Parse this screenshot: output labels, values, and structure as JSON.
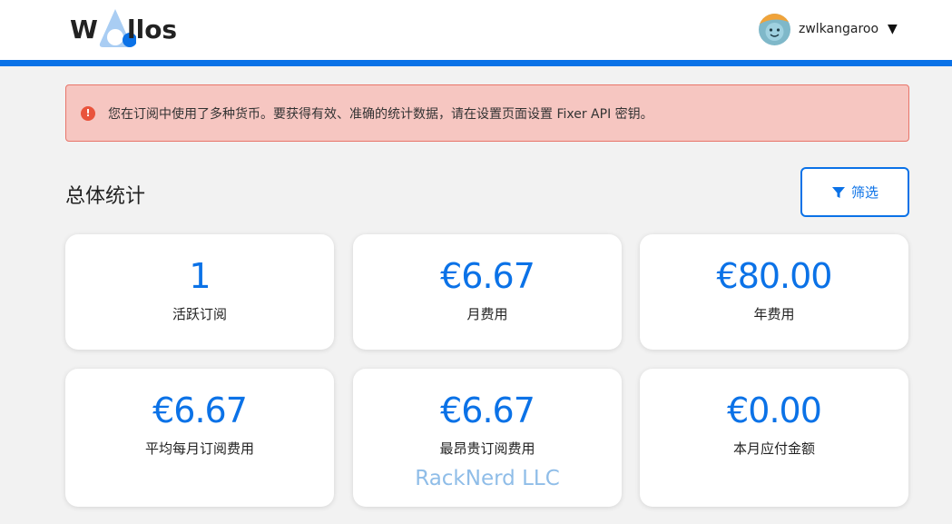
{
  "app": {
    "logo_left": "W",
    "logo_right": "llos"
  },
  "user": {
    "name": "zwlkangaroo",
    "caret": "▼"
  },
  "alert": {
    "icon": "!",
    "message": "您在订阅中使用了多种货币。要获得有效、准确的统计数据，请在设置页面设置 Fixer API 密钥。"
  },
  "section": {
    "title": "总体统计",
    "filter_label": "筛选"
  },
  "stats": [
    {
      "value": "1",
      "caption": "活跃订阅"
    },
    {
      "value": "€6.67",
      "caption": "月费用"
    },
    {
      "value": "€80.00",
      "caption": "年费用"
    },
    {
      "value": "€6.67",
      "caption": "平均每月订阅费用"
    },
    {
      "value": "€6.67",
      "caption": "最昂贵订阅费用",
      "extra": "RackNerd LLC"
    },
    {
      "value": "€0.00",
      "caption": "本月应付金额"
    }
  ],
  "colors": {
    "accent": "#0b72e7",
    "alert_bg": "#f6c6c1",
    "alert_border": "#e8756a"
  }
}
